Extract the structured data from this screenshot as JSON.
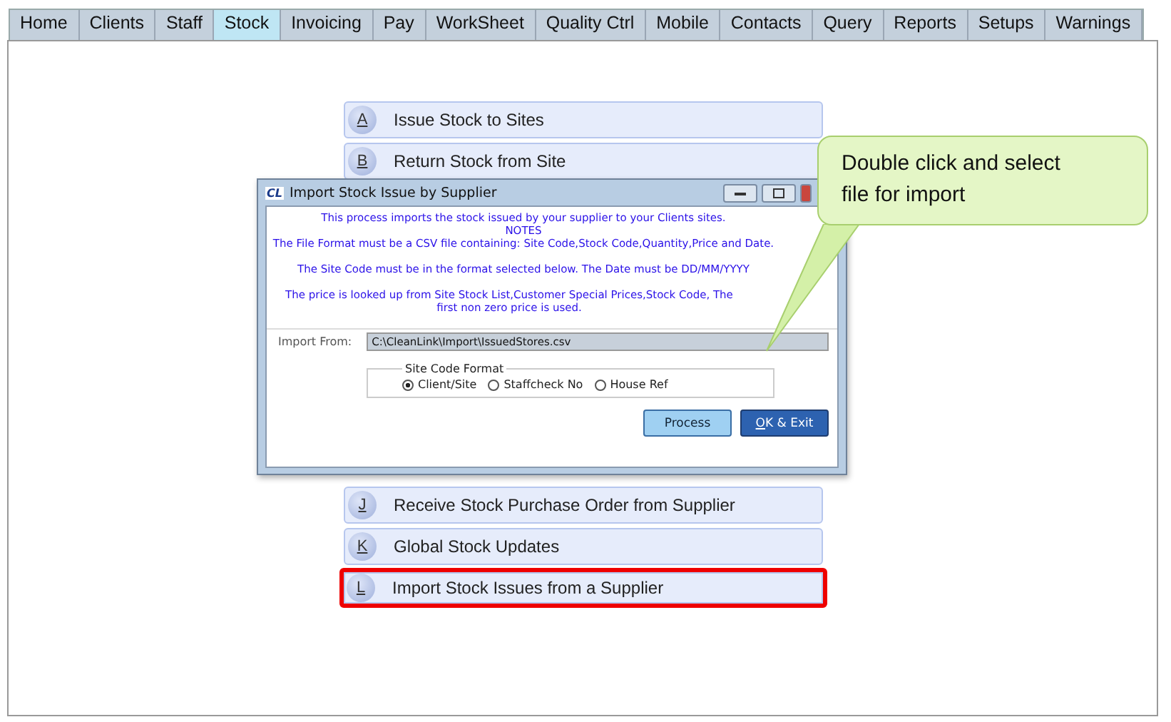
{
  "tabs": [
    {
      "label": "Home",
      "selected": false
    },
    {
      "label": "Clients",
      "selected": false
    },
    {
      "label": "Staff",
      "selected": false
    },
    {
      "label": "Stock",
      "selected": true
    },
    {
      "label": "Invoicing",
      "selected": false
    },
    {
      "label": "Pay",
      "selected": false
    },
    {
      "label": "WorkSheet",
      "selected": false
    },
    {
      "label": "Quality Ctrl",
      "selected": false
    },
    {
      "label": "Mobile",
      "selected": false
    },
    {
      "label": "Contacts",
      "selected": false
    },
    {
      "label": "Query",
      "selected": false
    },
    {
      "label": "Reports",
      "selected": false
    },
    {
      "label": "Setups",
      "selected": false
    },
    {
      "label": "Warnings",
      "selected": false
    }
  ],
  "menu_top": [
    {
      "key": "A",
      "label": "Issue Stock to Sites",
      "highlighted": false
    },
    {
      "key": "B",
      "label": "Return Stock from Site",
      "highlighted": false
    }
  ],
  "menu_bottom": [
    {
      "key": "J",
      "label": "Receive Stock Purchase Order from Supplier",
      "highlighted": false
    },
    {
      "key": "K",
      "label": "Global Stock Updates",
      "highlighted": false
    },
    {
      "key": "L",
      "label": "Import Stock Issues from a Supplier",
      "highlighted": true
    }
  ],
  "dialog": {
    "logo": "CL",
    "title": "Import Stock Issue by Supplier",
    "notes": [
      {
        "text": "This process imports the stock issued by your supplier to your Clients sites.",
        "space_before": false
      },
      {
        "text": "NOTES",
        "space_before": false
      },
      {
        "text": "The File Format must be a CSV file containing: Site Code,Stock Code,Quantity,Price and Date.",
        "space_before": false
      },
      {
        "text": "The Site Code must be in the format selected below. The Date must be DD/MM/YYYY",
        "space_before": true
      },
      {
        "text": "The price is looked up from Site Stock List,Customer Special Prices,Stock Code, The first non zero price is used.",
        "space_before": true
      }
    ],
    "import_label": "Import From:",
    "import_value": "C:\\CleanLink\\Import\\IssuedStores.csv",
    "group_title": "Site Code Format",
    "options": [
      {
        "label": "Client/Site",
        "selected": true
      },
      {
        "label": "Staffcheck No",
        "selected": false
      },
      {
        "label": "House Ref",
        "selected": false
      }
    ],
    "buttons": [
      {
        "label": "Process",
        "kind": "normal"
      },
      {
        "label": "OK & Exit",
        "kind": "default"
      }
    ]
  },
  "callout": {
    "text": "Double  click and  select file for import"
  }
}
